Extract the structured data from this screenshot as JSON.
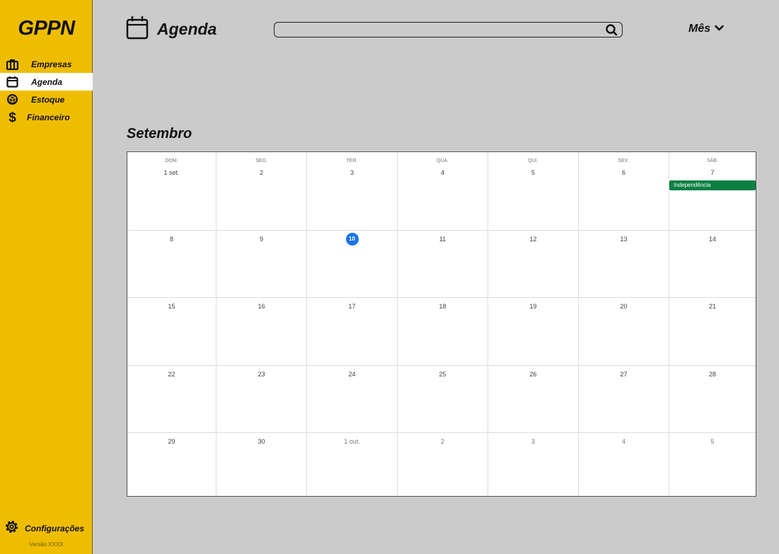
{
  "sidebar": {
    "logo": "GPPN",
    "items": [
      {
        "label": "Empresas",
        "icon": "briefcase-icon",
        "active": false
      },
      {
        "label": "Agenda",
        "icon": "calendar-icon",
        "active": true
      },
      {
        "label": "Estoque",
        "icon": "box-icon",
        "active": false
      },
      {
        "label": "Financeiro",
        "icon": "dollar-icon",
        "active": false
      }
    ],
    "settings_label": "Configurações",
    "version": "Versão XXXX"
  },
  "header": {
    "title": "Agenda",
    "search_value": "",
    "view_label": "Mês"
  },
  "calendar": {
    "month_title": "Setembro",
    "weekdays": [
      "DOM.",
      "SEG.",
      "TER.",
      "QUA.",
      "QUI.",
      "SEX.",
      "SÁB."
    ],
    "weeks": [
      [
        "1 set.",
        "2",
        "3",
        "4",
        "5",
        "6",
        "7"
      ],
      [
        "8",
        "9",
        "10",
        "11",
        "12",
        "13",
        "14"
      ],
      [
        "15",
        "16",
        "17",
        "18",
        "19",
        "20",
        "21"
      ],
      [
        "22",
        "23",
        "24",
        "25",
        "26",
        "27",
        "28"
      ],
      [
        "29",
        "30",
        "1 out.",
        "2",
        "3",
        "4",
        "5"
      ]
    ],
    "today": "10",
    "event": {
      "label": "Independência",
      "day": "7",
      "color": "#0b8043"
    }
  },
  "colors": {
    "sidebar": "#efbd00",
    "background": "#cbcbcb",
    "today": "#1a73e8"
  }
}
